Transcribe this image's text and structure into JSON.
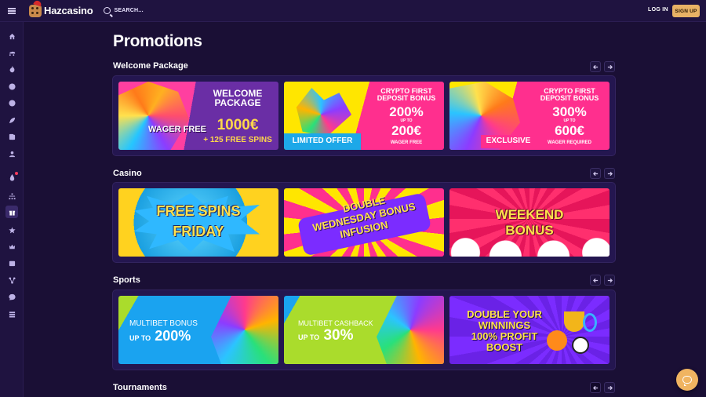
{
  "header": {
    "logo_text": "Hazcasino",
    "search_label": "SEARCH...",
    "login_label": "LOG IN",
    "signup_label": "SIGN UP"
  },
  "sidebar": {
    "items": [
      {
        "icon": "home-icon"
      },
      {
        "icon": "sports-car-icon"
      },
      {
        "icon": "flame-icon"
      },
      {
        "icon": "chip-icon"
      },
      {
        "icon": "basketball-icon"
      },
      {
        "icon": "rocket-icon"
      },
      {
        "icon": "cards-icon"
      },
      {
        "icon": "user-icon"
      },
      {
        "icon": "live-drop-icon",
        "notification": true
      },
      {
        "icon": "sitemap-icon"
      },
      {
        "icon": "gift-icon",
        "active": true
      },
      {
        "icon": "star-icon"
      },
      {
        "icon": "crown-icon"
      },
      {
        "icon": "wallet-icon"
      },
      {
        "icon": "affiliate-icon"
      },
      {
        "icon": "chat-icon"
      },
      {
        "icon": "stack-icon"
      }
    ]
  },
  "page_title": "Promotions",
  "sections": [
    {
      "title": "Welcome Package",
      "cards": [
        {
          "wager": "WAGER FREE",
          "line1": "WELCOME PACKAGE",
          "line2": "1000€",
          "line3": "+ 125 FREE SPINS"
        },
        {
          "line1": "CRYPTO FIRST DEPOSIT BONUS",
          "line2": "200%",
          "upto": "UP TO",
          "line3": "200€",
          "line4": "WAGER FREE",
          "badge": "LIMITED OFFER"
        },
        {
          "line1": "CRYPTO FIRST DEPOSIT BONUS",
          "line2": "300%",
          "upto": "UP TO",
          "line3": "600€",
          "line4": "WAGER REQUIRED",
          "badge": "EXCLUSIVE"
        }
      ]
    },
    {
      "title": "Casino",
      "cards": [
        {
          "line1": "FREE SPINS",
          "line2": "FRIDAY"
        },
        {
          "line1": "DOUBLE",
          "line2": "WEDNESDAY BONUS",
          "line3": "INFUSION"
        },
        {
          "line1": "WEEKEND",
          "line2": "BONUS"
        }
      ]
    },
    {
      "title": "Sports",
      "cards": [
        {
          "line1": "MULTIBET BONUS",
          "line2_small": "UP TO",
          "line2": "200%"
        },
        {
          "line1": "MULTIBET CASHBACK",
          "line2_small": "UP TO",
          "line2": "30%"
        },
        {
          "line1": "DOUBLE YOUR",
          "line2": "WINNINGS",
          "line3": "100% PROFIT",
          "line4": "BOOST"
        }
      ]
    },
    {
      "title": "Tournaments"
    }
  ]
}
